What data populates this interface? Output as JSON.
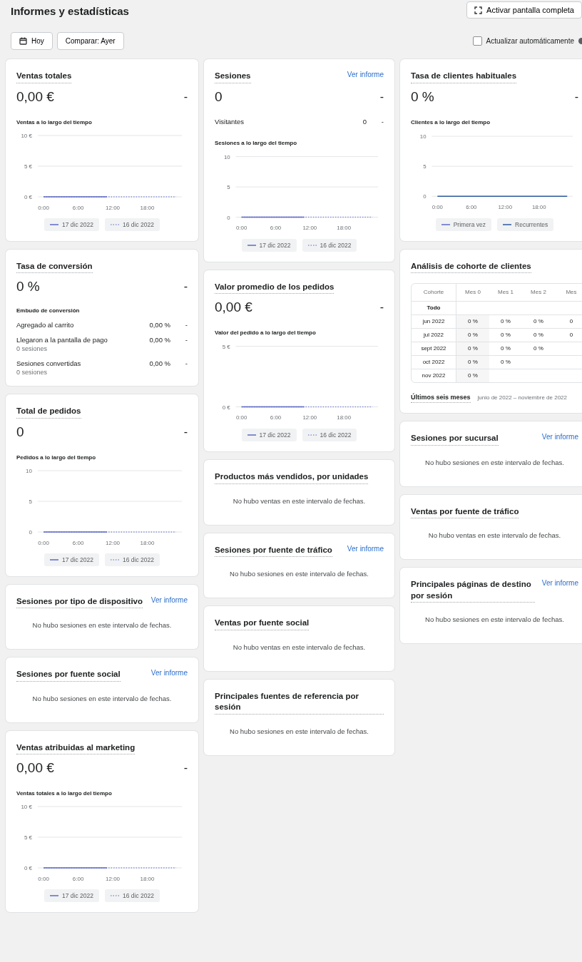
{
  "header": {
    "title": "Informes y estadísticas",
    "fullscreen_button": "Activar pantalla completa",
    "date_button": "Hoy",
    "compare_button": "Comparar: Ayer",
    "auto_refresh": {
      "label": "Actualizar automáticamente",
      "checked": false
    }
  },
  "columns": [
    [
      {
        "kind": "metric",
        "title": "Ventas totales",
        "value": "0,00 €",
        "change": "-",
        "chart_title": "Ventas a lo largo del tiempo",
        "chart_data": {
          "type": "line",
          "legend": "bottom",
          "x": [
            0,
            6,
            11,
            12,
            18,
            23
          ],
          "xlim": [
            -1,
            24
          ],
          "ylim": [
            0,
            10
          ],
          "xticks": [
            {
              "value": 0,
              "label": "0:00"
            },
            {
              "value": 6,
              "label": "6:00"
            },
            {
              "value": 12,
              "label": "12:00"
            },
            {
              "value": 18,
              "label": "18:00"
            }
          ],
          "yticks": [
            {
              "value": 0,
              "label": "0 €"
            },
            {
              "value": 5,
              "label": "5 €"
            },
            {
              "value": 10,
              "label": "10 €"
            }
          ],
          "series": [
            {
              "name": "17 dic 2022",
              "color": "#5c6ac4",
              "line_style": "solid",
              "values": [
                0,
                0,
                0,
                null,
                null,
                null
              ]
            },
            {
              "name": "16 dic 2022",
              "color": "#8a94d6",
              "line_style": "dotted",
              "values": [
                0,
                0,
                0,
                0,
                0,
                0
              ]
            }
          ]
        }
      },
      {
        "kind": "funnel",
        "title": "Tasa de conversión",
        "value": "0 %",
        "change": "-",
        "funnel_title": "Embudo de conversión",
        "steps": [
          {
            "label": "Agregado al carrito",
            "percent": "0,00 %",
            "change": "-"
          },
          {
            "label": "Llegaron a la pantalla de pago",
            "percent": "0,00 %",
            "change": "-",
            "sub": "0 sesiones"
          },
          {
            "label": "Sesiones convertidas",
            "percent": "0,00 %",
            "change": "-",
            "sub": "0 sesiones"
          }
        ]
      },
      {
        "kind": "metric",
        "title": "Total de pedidos",
        "value": "0",
        "change": "-",
        "chart_title": "Pedidos a lo largo del tiempo",
        "chart_data": {
          "type": "line",
          "legend": "bottom",
          "x": [
            0,
            6,
            11,
            12,
            18,
            23
          ],
          "xlim": [
            -1,
            24
          ],
          "ylim": [
            0,
            10
          ],
          "xticks": [
            {
              "value": 0,
              "label": "0:00"
            },
            {
              "value": 6,
              "label": "6:00"
            },
            {
              "value": 12,
              "label": "12:00"
            },
            {
              "value": 18,
              "label": "18:00"
            }
          ],
          "yticks": [
            0,
            5,
            10
          ],
          "series": [
            {
              "name": "17 dic 2022",
              "color": "#5c6ac4",
              "line_style": "solid",
              "values": [
                0,
                0,
                0,
                null,
                null,
                null
              ]
            },
            {
              "name": "16 dic 2022",
              "color": "#8a94d6",
              "line_style": "dotted",
              "values": [
                0,
                0,
                0,
                0,
                0,
                0
              ]
            }
          ]
        }
      },
      {
        "kind": "empty",
        "title": "Sesiones por tipo de dispositivo",
        "link": "Ver informe",
        "message": "No hubo sesiones en este intervalo de fechas."
      },
      {
        "kind": "empty",
        "title": "Sesiones por fuente social",
        "link": "Ver informe",
        "message": "No hubo sesiones en este intervalo de fechas."
      },
      {
        "kind": "metric",
        "title": "Ventas atribuidas al marketing",
        "value": "0,00 €",
        "change": "-",
        "chart_title": "Ventas totales a lo largo del tiempo",
        "chart_data": {
          "type": "line",
          "legend": "bottom",
          "x": [
            0,
            6,
            11,
            12,
            18,
            23
          ],
          "xlim": [
            -1,
            24
          ],
          "ylim": [
            0,
            10
          ],
          "xticks": [
            {
              "value": 0,
              "label": "0:00"
            },
            {
              "value": 6,
              "label": "6:00"
            },
            {
              "value": 12,
              "label": "12:00"
            },
            {
              "value": 18,
              "label": "18:00"
            }
          ],
          "yticks": [
            {
              "value": 0,
              "label": "0 €"
            },
            {
              "value": 5,
              "label": "5 €"
            },
            {
              "value": 10,
              "label": "10 €"
            }
          ],
          "series": [
            {
              "name": "17 dic 2022",
              "color": "#5c6ac4",
              "line_style": "solid",
              "values": [
                0,
                0,
                0,
                null,
                null,
                null
              ]
            },
            {
              "name": "16 dic 2022",
              "color": "#8a94d6",
              "line_style": "dotted",
              "values": [
                0,
                0,
                0,
                0,
                0,
                0
              ]
            }
          ]
        }
      }
    ],
    [
      {
        "kind": "metric",
        "title": "Sesiones",
        "link": "Ver informe",
        "value": "0",
        "change": "-",
        "rows": [
          {
            "label": "Visitantes",
            "value": "0",
            "change": "-"
          }
        ],
        "chart_title": "Sesiones a lo largo del tiempo",
        "chart_data": {
          "type": "line",
          "legend": "bottom",
          "x": [
            0,
            6,
            11,
            12,
            18,
            23
          ],
          "xlim": [
            -1,
            24
          ],
          "ylim": [
            0,
            10
          ],
          "xticks": [
            {
              "value": 0,
              "label": "0:00"
            },
            {
              "value": 6,
              "label": "6:00"
            },
            {
              "value": 12,
              "label": "12:00"
            },
            {
              "value": 18,
              "label": "18:00"
            }
          ],
          "yticks": [
            0,
            5,
            10
          ],
          "series": [
            {
              "name": "17 dic 2022",
              "color": "#5c6ac4",
              "line_style": "solid",
              "values": [
                0,
                0,
                0,
                null,
                null,
                null
              ]
            },
            {
              "name": "16 dic 2022",
              "color": "#8a94d6",
              "line_style": "dotted",
              "values": [
                0,
                0,
                0,
                0,
                0,
                0
              ]
            }
          ]
        }
      },
      {
        "kind": "metric",
        "title": "Valor promedio de los pedidos",
        "value": "0,00 €",
        "change": "-",
        "chart_title": "Valor del pedido a lo largo del tiempo",
        "chart_data": {
          "type": "line",
          "legend": "bottom",
          "x": [
            0,
            6,
            11,
            12,
            18,
            23
          ],
          "xlim": [
            -1,
            24
          ],
          "ylim": [
            0,
            5
          ],
          "xticks": [
            {
              "value": 0,
              "label": "0:00"
            },
            {
              "value": 6,
              "label": "6:00"
            },
            {
              "value": 12,
              "label": "12:00"
            },
            {
              "value": 18,
              "label": "18:00"
            }
          ],
          "yticks": [
            {
              "value": 0,
              "label": "0 €"
            },
            {
              "value": 5,
              "label": "5 €"
            }
          ],
          "series": [
            {
              "name": "17 dic 2022",
              "color": "#5c6ac4",
              "line_style": "solid",
              "values": [
                0,
                0,
                0,
                null,
                null,
                null
              ]
            },
            {
              "name": "16 dic 2022",
              "color": "#8a94d6",
              "line_style": "dotted",
              "values": [
                0,
                0,
                0,
                0,
                0,
                0
              ]
            }
          ]
        }
      },
      {
        "kind": "empty",
        "title": "Productos más vendidos, por unidades",
        "message": "No hubo ventas en este intervalo de fechas."
      },
      {
        "kind": "empty",
        "title": "Sesiones por fuente de tráfico",
        "link": "Ver informe",
        "message": "No hubo sesiones en este intervalo de fechas."
      },
      {
        "kind": "empty",
        "title": "Ventas por fuente social",
        "message": "No hubo ventas en este intervalo de fechas."
      },
      {
        "kind": "empty",
        "title": "Principales fuentes de referencia por sesión",
        "message": "No hubo sesiones en este intervalo de fechas."
      }
    ],
    [
      {
        "kind": "metric",
        "title": "Tasa de clientes habituales",
        "value": "0 %",
        "change": "-",
        "chart_title": "Clientes a lo largo del tiempo",
        "chart_data": {
          "type": "line",
          "legend": "bottom",
          "x": [
            0,
            23
          ],
          "xlim": [
            -1,
            24
          ],
          "ylim": [
            0,
            10
          ],
          "xticks": [
            {
              "value": 0,
              "label": "0:00"
            },
            {
              "value": 6,
              "label": "6:00"
            },
            {
              "value": 12,
              "label": "12:00"
            },
            {
              "value": 18,
              "label": "18:00"
            }
          ],
          "yticks": [
            0,
            5,
            10
          ],
          "series": [
            {
              "name": "Primera vez",
              "color": "#5c6ac4",
              "line_style": "solid",
              "values": [
                null,
                null
              ]
            },
            {
              "name": "Recurrentes",
              "color": "#2c5a9e",
              "line_style": "solid",
              "values": [
                0,
                0
              ]
            }
          ]
        }
      },
      {
        "kind": "cohort",
        "title": "Análisis de cohorte de clientes",
        "columns": [
          "Cohorte",
          "Mes 0",
          "Mes 1",
          "Mes 2",
          "Mes"
        ],
        "rows": [
          {
            "cells": [
              "Todo"
            ]
          },
          {
            "cells": [
              "jun 2022",
              "0 %",
              "0 %",
              "0 %",
              "0"
            ]
          },
          {
            "cells": [
              "jul 2022",
              "0 %",
              "0 %",
              "0 %",
              "0"
            ]
          },
          {
            "cells": [
              "sept 2022",
              "0 %",
              "0 %",
              "0 %"
            ]
          },
          {
            "cells": [
              "oct 2022",
              "0 %",
              "0 %"
            ]
          },
          {
            "cells": [
              "nov 2022",
              "0 %"
            ]
          }
        ],
        "footer_label": "Últimos seis meses",
        "footer_range": "junio de 2022 – noviembre de 2022"
      },
      {
        "kind": "empty",
        "title": "Sesiones por sucursal",
        "link": "Ver informe",
        "message": "No hubo sesiones en este intervalo de fechas."
      },
      {
        "kind": "empty",
        "title": "Ventas por fuente de tráfico",
        "message": "No hubo ventas en este intervalo de fechas."
      },
      {
        "kind": "empty",
        "title": "Principales páginas de destino por sesión",
        "link": "Ver informe",
        "message": "No hubo sesiones en este intervalo de fechas."
      }
    ]
  ]
}
